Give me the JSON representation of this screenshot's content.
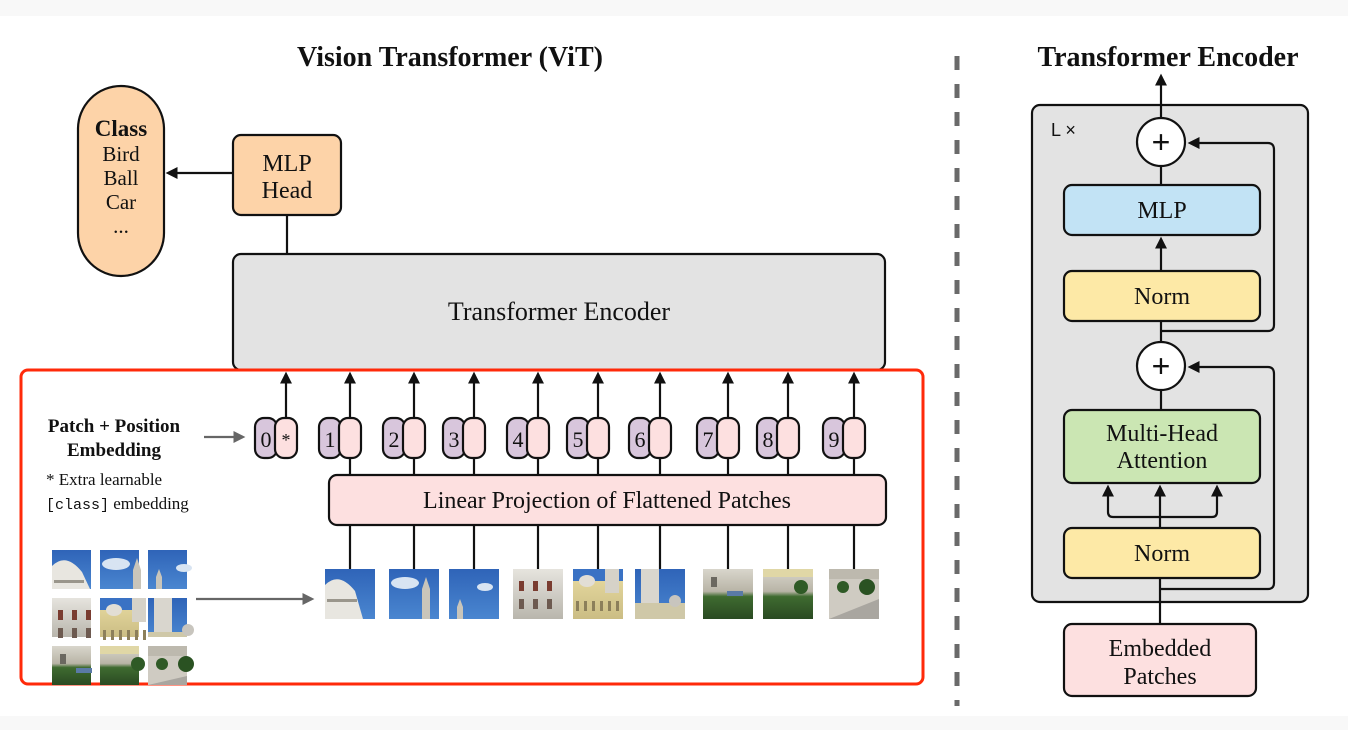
{
  "colors": {
    "orange": "#fdd3a8",
    "encoder_gray": "#e3e3e3",
    "pink": "#fde0e0",
    "purple": "#d8c6dc",
    "mlp_blue": "#c2e3f5",
    "norm_yellow": "#fde9a6",
    "attn_green": "#cbe6b3",
    "highlight_red": "#ff2a0a",
    "divider_gray": "#6a6a6a"
  },
  "vit": {
    "title": "Vision Transformer (ViT)",
    "class_box": {
      "heading": "Class",
      "items": [
        "Bird",
        "Ball",
        "Car",
        "..."
      ]
    },
    "mlp_head": {
      "line1": "MLP",
      "line2": "Head"
    },
    "encoder_label": "Transformer Encoder",
    "embedding_label": {
      "line1": "Patch + Position",
      "line2": "Embedding"
    },
    "footnote": {
      "line1": "* Extra learnable",
      "line2_code": "[class]",
      "line2_rest": " embedding"
    },
    "tokens": [
      {
        "position": "0",
        "patch": "*"
      },
      {
        "position": "1",
        "patch": ""
      },
      {
        "position": "2",
        "patch": ""
      },
      {
        "position": "3",
        "patch": ""
      },
      {
        "position": "4",
        "patch": ""
      },
      {
        "position": "5",
        "patch": ""
      },
      {
        "position": "6",
        "patch": ""
      },
      {
        "position": "7",
        "patch": ""
      },
      {
        "position": "8",
        "patch": ""
      },
      {
        "position": "9",
        "patch": ""
      }
    ],
    "projection_label": "Linear Projection of Flattened Patches",
    "patches": [
      {
        "name": "dome-sky"
      },
      {
        "name": "sky-tower"
      },
      {
        "name": "sky-spire"
      },
      {
        "name": "white-facade"
      },
      {
        "name": "yellow-palace"
      },
      {
        "name": "tower-facade"
      },
      {
        "name": "street-cars"
      },
      {
        "name": "hedge-garden"
      },
      {
        "name": "plaza-trees"
      }
    ]
  },
  "encoder_detail": {
    "title": "Transformer Encoder",
    "repeat_label": "L ×",
    "plus_symbol": "+",
    "mlp_label": "MLP",
    "norm_label": "Norm",
    "attention": {
      "line1": "Multi-Head",
      "line2": "Attention"
    },
    "input": {
      "line1": "Embedded",
      "line2": "Patches"
    }
  }
}
